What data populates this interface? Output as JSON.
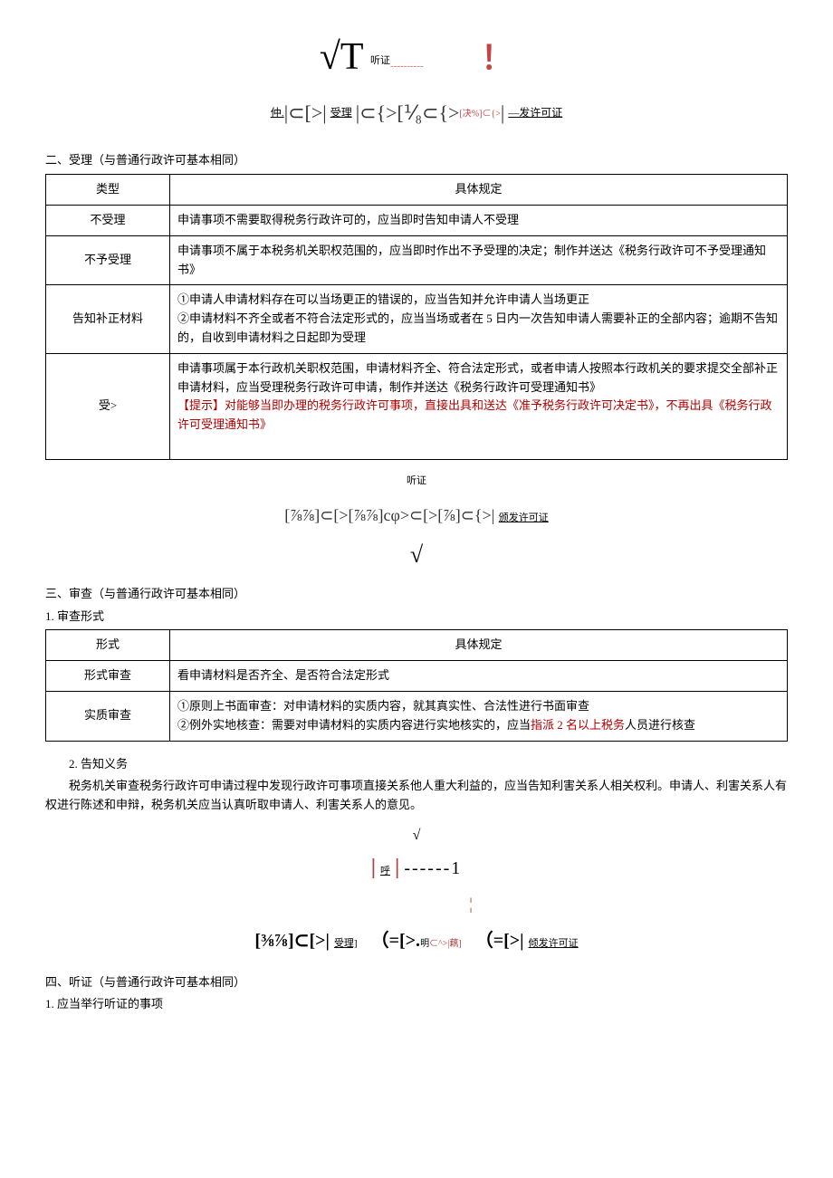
{
  "diagram1": {
    "sqrt": "√T",
    "hearing": "听证",
    "dashes": "----------",
    "excl": "！"
  },
  "flow1": {
    "prefix": "仲.",
    "seg1": "|⊂[>|",
    "shouli": "受理",
    "seg2": "|⊂{>[⅟₈⊂{>",
    "jue": "[决%]⊂{>",
    "seg3": "|",
    "fa": "—发许可证"
  },
  "section2_title": "二、受理（与普通行政许可基本相同）",
  "table1": {
    "h1": "类型",
    "h2": "具体规定",
    "r1c1": "不受理",
    "r1c2": "申请事项不需要取得税务行政许可的，应当即时告知申请人不受理",
    "r2c1": "不予受理",
    "r2c2": "申请事项不属于本税务机关职权范围的，应当即时作出不予受理的决定；制作并送达《税务行政许可不予受理通知书》",
    "r3c1": "告知补正材料",
    "r3c2": "①申请人申请材料存在可以当场更正的错误的，应当告知并允许申请人当场更正\n②申请材料不齐全或者不符合法定形式的，应当当场或者在 5 日内一次告知申请人需要补正的全部内容；逾期不告知的，自收到申请材料之日起即为受理",
    "r4c1": "受>",
    "r4c2_p1": "申请事项属于本行政机关职权范围，申请材料齐全、符合法定形式，或者申请人按照本行政机关的要求提交全部补正申请材料，应当受理税务行政许可申请，制作并送达《税务行政许可受理通知书》",
    "r4c2_p2": "【提示】对能够当即办理的税务行政许可事项，直接出具和送达《准予税务行政许可决定书》，不再出具《税务行政许可受理通知书》"
  },
  "hearing_center": "听证",
  "flow2": {
    "seg1": "[⅞⅞]⊂[>[⅞⅞]cφ>⊂[>[⅞]⊂{>|",
    "lbl": "颁发许可证"
  },
  "sqrt_center": "√",
  "section3_title": "三、审查（与普通行政许可基本相同）",
  "section3_sub1": "1. 审查形式",
  "table2": {
    "h1": "形式",
    "h2": "具体规定",
    "r1c1": "形式审查",
    "r1c2": "看申请材料是否齐全、是否符合法定形式",
    "r2c1": "实质审查",
    "r2c2_p1": "①原则上书面审查：对申请材料的实质内容，就其真实性、合法性进行书面审查",
    "r2c2_p2a": "②例外实地核查：需要对申请材料的实质内容进行实地核实的，应当",
    "r2c2_p2b": "指派 2 名以上税务",
    "r2c2_p2c": "人员进行核查"
  },
  "section3_sub2": "2. 告知义务",
  "para3": "税务机关审查税务行政许可申请过程中发现行政许可事项直接关系他人重大利益的，应当告知利害关系人相关权利。申请人、利害关系人有权进行陈述和申辩，税务机关应当认真听取申请人、利害关系人的意见。",
  "diagram3": {
    "check": "√",
    "bar1": "|",
    "hu": "呼",
    "bar2": "|",
    "dashes": "------1",
    "vdash": "¦"
  },
  "flow3": {
    "seg1": "[⅜⅞]⊂[>|",
    "shouli": "受理]",
    "seg2": "（=[>.",
    "ming": "明",
    "tiny": "⊂^>|藕]",
    "seg3": "（=[>|",
    "ban": "倾发许可证"
  },
  "section4_title": "四、听证（与普通行政许可基本相同）",
  "section4_sub1": "1. 应当举行听证的事项"
}
